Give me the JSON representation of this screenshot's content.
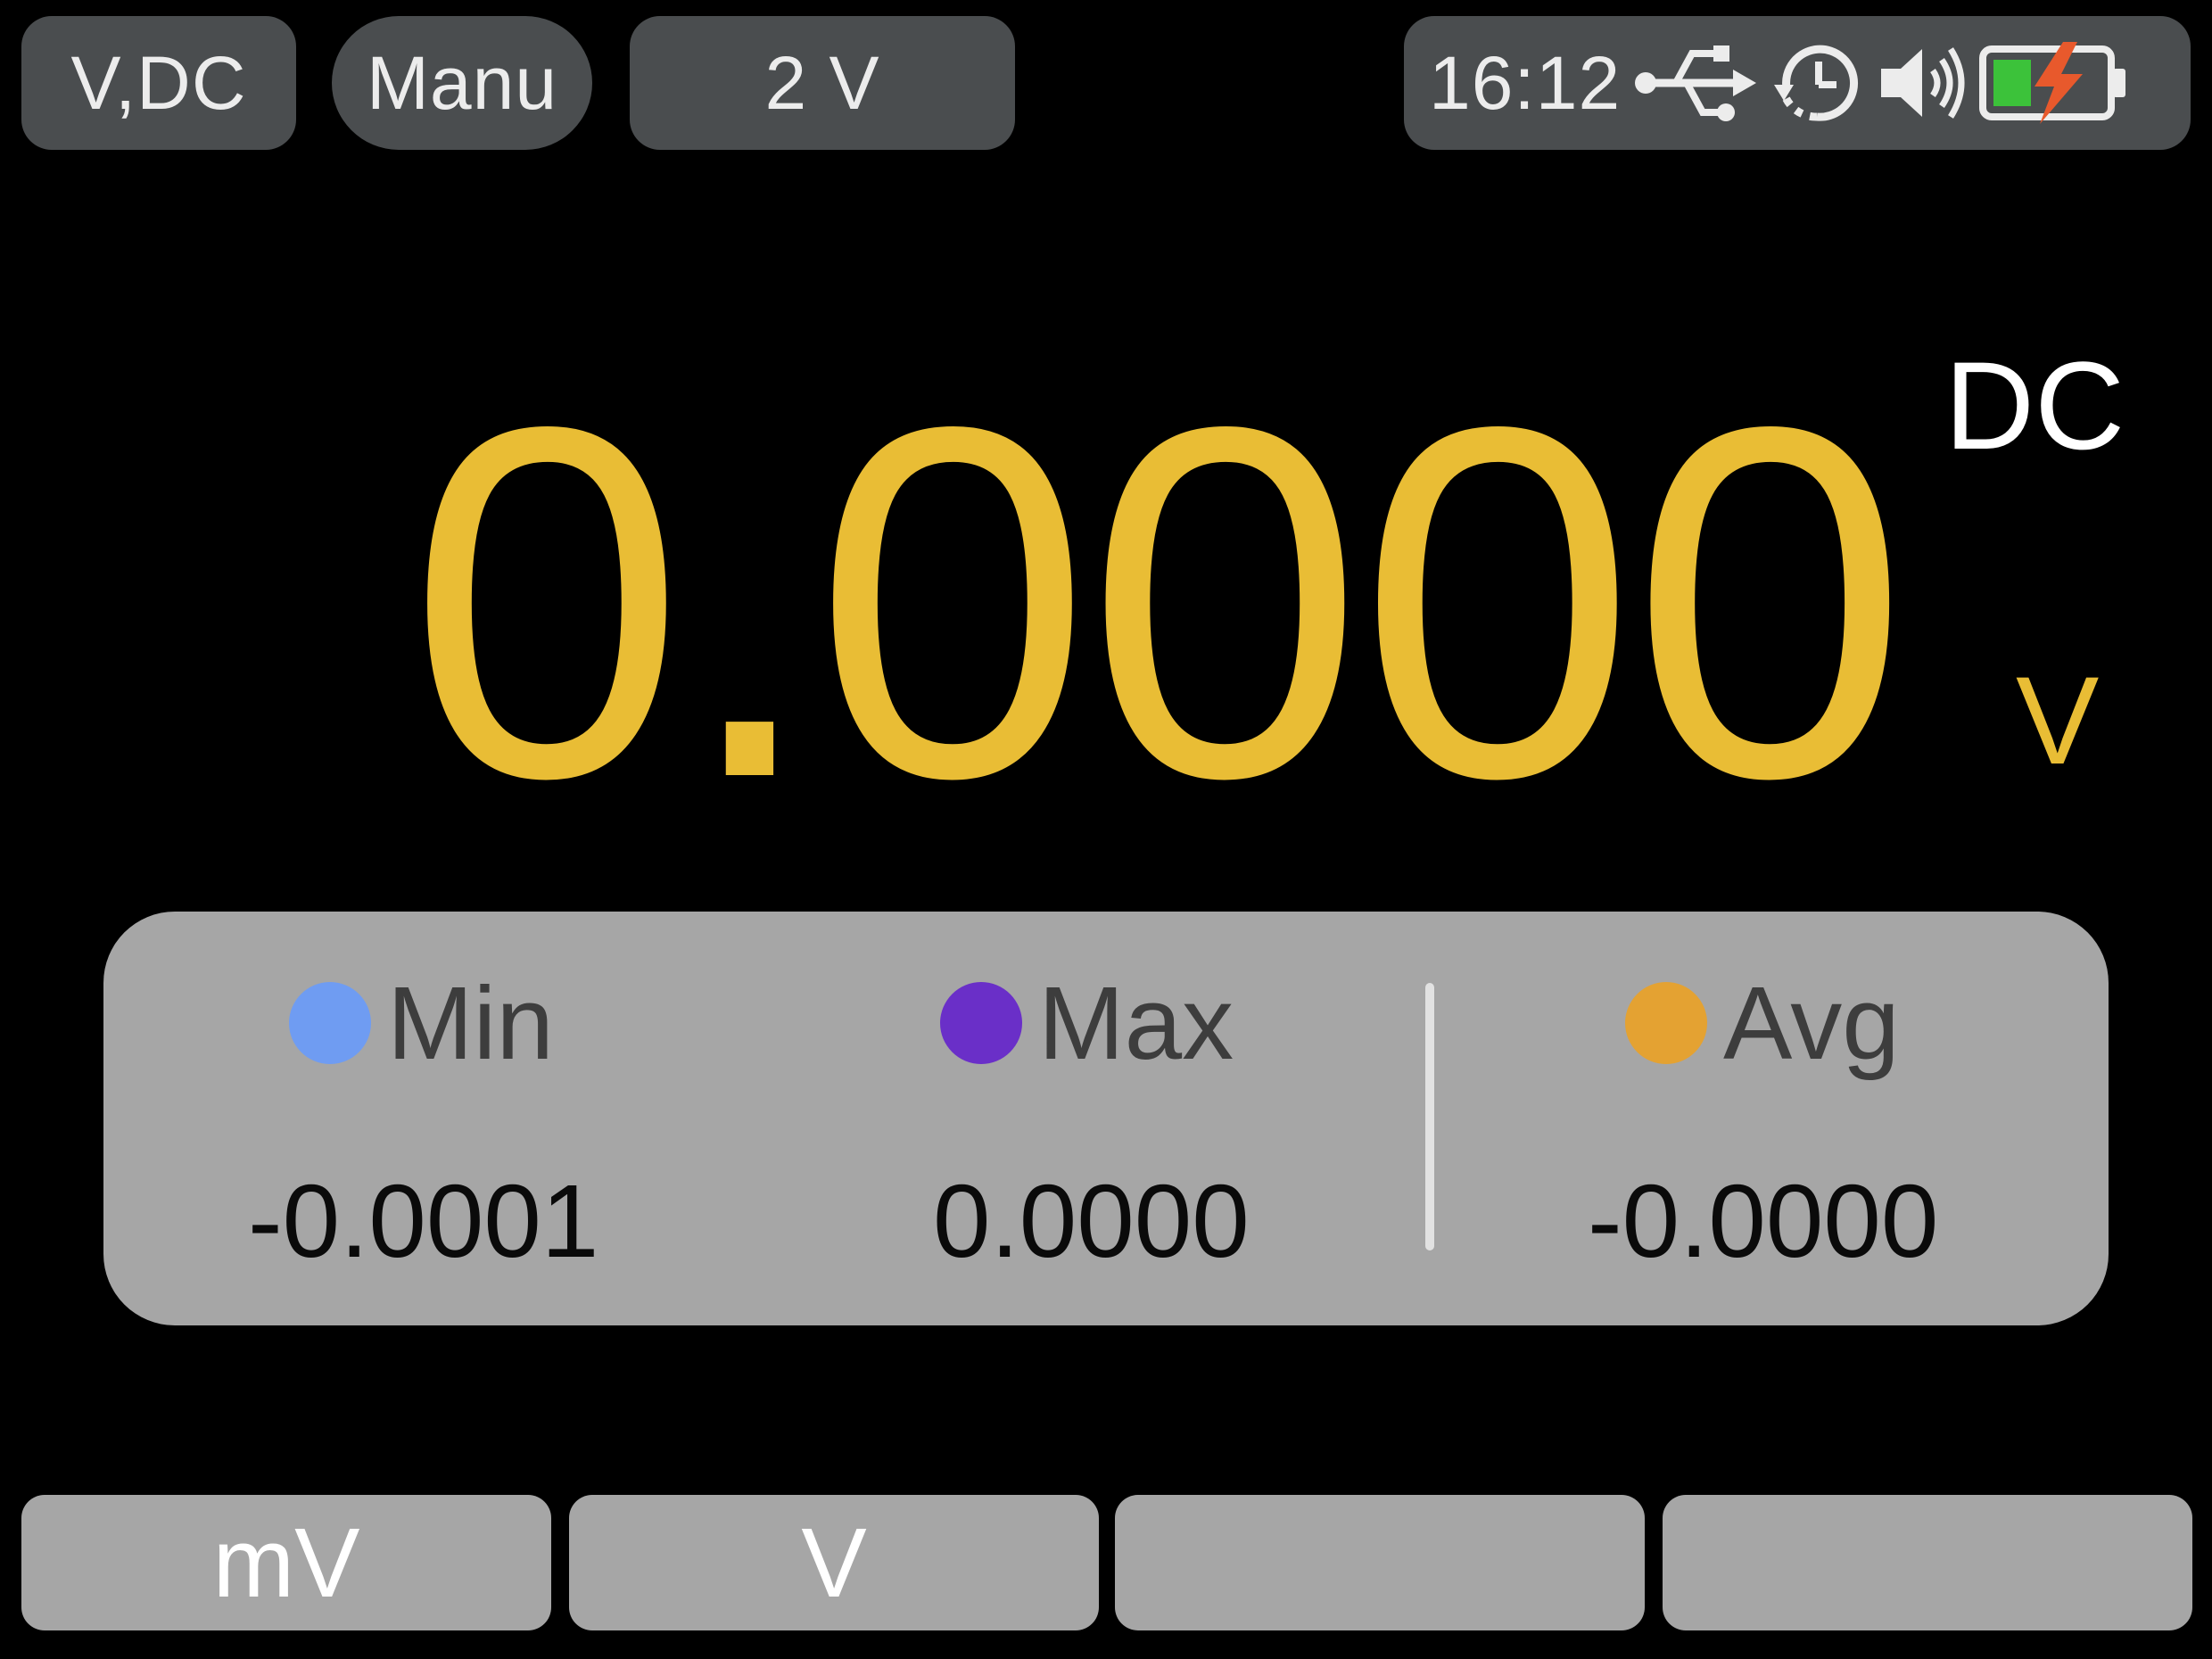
{
  "header": {
    "mode": "V,DC",
    "range_mode": "Manu",
    "range": "2 V",
    "status": {
      "time": "16:12",
      "icons": [
        "usb-icon",
        "auto-power-off-timer-icon",
        "speaker-icon",
        "battery-charging-icon"
      ],
      "battery_level_fraction": 0.35
    }
  },
  "reading": {
    "value": "0.0000",
    "coupling": "DC",
    "unit": "V",
    "color": "#e9bd35"
  },
  "stats": {
    "min": {
      "label": "Min",
      "value": "-0.0001",
      "color": "#6f9cf2"
    },
    "max": {
      "label": "Max",
      "value": "0.0000",
      "color": "#6a2fc8"
    },
    "avg": {
      "label": "Avg",
      "value": "-0.0000",
      "color": "#e4a232"
    }
  },
  "softkeys": [
    "mV",
    "V",
    "",
    ""
  ]
}
